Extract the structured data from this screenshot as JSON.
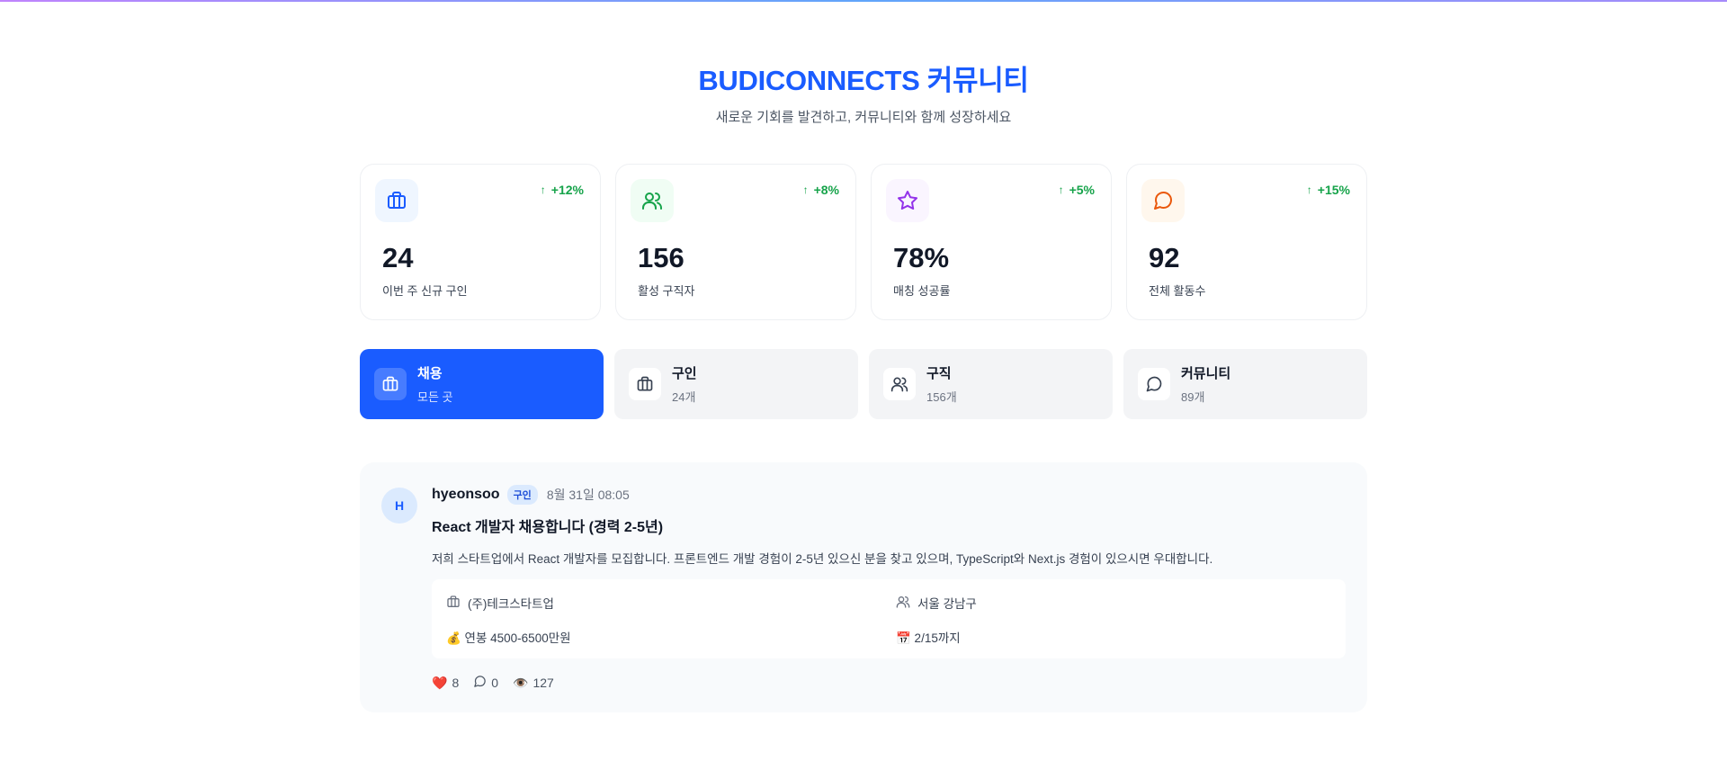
{
  "header": {
    "title": "BUDICONNECTS 커뮤니티",
    "subtitle": "새로운 기회를 발견하고, 커뮤니티와 함께 성장하세요"
  },
  "stats": [
    {
      "value": "24",
      "label": "이번 주 신규 구인",
      "change": "+12%",
      "icon": "briefcase-icon",
      "color": "#1a5cff",
      "bg": "#eff6ff"
    },
    {
      "value": "156",
      "label": "활성 구직자",
      "change": "+8%",
      "icon": "users-icon",
      "color": "#16a34a",
      "bg": "#f0fdf4"
    },
    {
      "value": "78%",
      "label": "매칭 성공률",
      "change": "+5%",
      "icon": "star-icon",
      "color": "#9333ea",
      "bg": "#faf5ff"
    },
    {
      "value": "92",
      "label": "전체 활동수",
      "change": "+15%",
      "icon": "message-circle-icon",
      "color": "#ea580c",
      "bg": "#fff7ed"
    }
  ],
  "tabs": [
    {
      "title": "채용",
      "sub": "모든 곳",
      "icon": "briefcase-icon",
      "active": true
    },
    {
      "title": "구인",
      "sub": "24개",
      "icon": "briefcase-icon",
      "active": false
    },
    {
      "title": "구직",
      "sub": "156개",
      "icon": "users-icon",
      "active": false
    },
    {
      "title": "커뮤니티",
      "sub": "89개",
      "icon": "message-circle-icon",
      "active": false
    }
  ],
  "post": {
    "avatar": "H",
    "author": "hyeonsoo",
    "badge": "구인",
    "date": "8월 31일 08:05",
    "title": "React 개발자 채용합니다 (경력 2-5년)",
    "content": "저희 스타트업에서 React 개발자를 모집합니다. 프론트엔드 개발 경험이 2-5년 있으신 분을 찾고 있으며, TypeScript와 Next.js 경험이 있으시면 우대합니다.",
    "company": "(주)테크스타트업",
    "location": "서울 강남구",
    "salary": "💰 연봉 4500-6500만원",
    "deadline": "📅 2/15까지",
    "likes": "8",
    "comments": "0",
    "views": "127",
    "like_icon": "❤️",
    "view_icon": "👁️"
  },
  "colors": {
    "accent": "#1a5cff",
    "positive": "#16a34a"
  }
}
